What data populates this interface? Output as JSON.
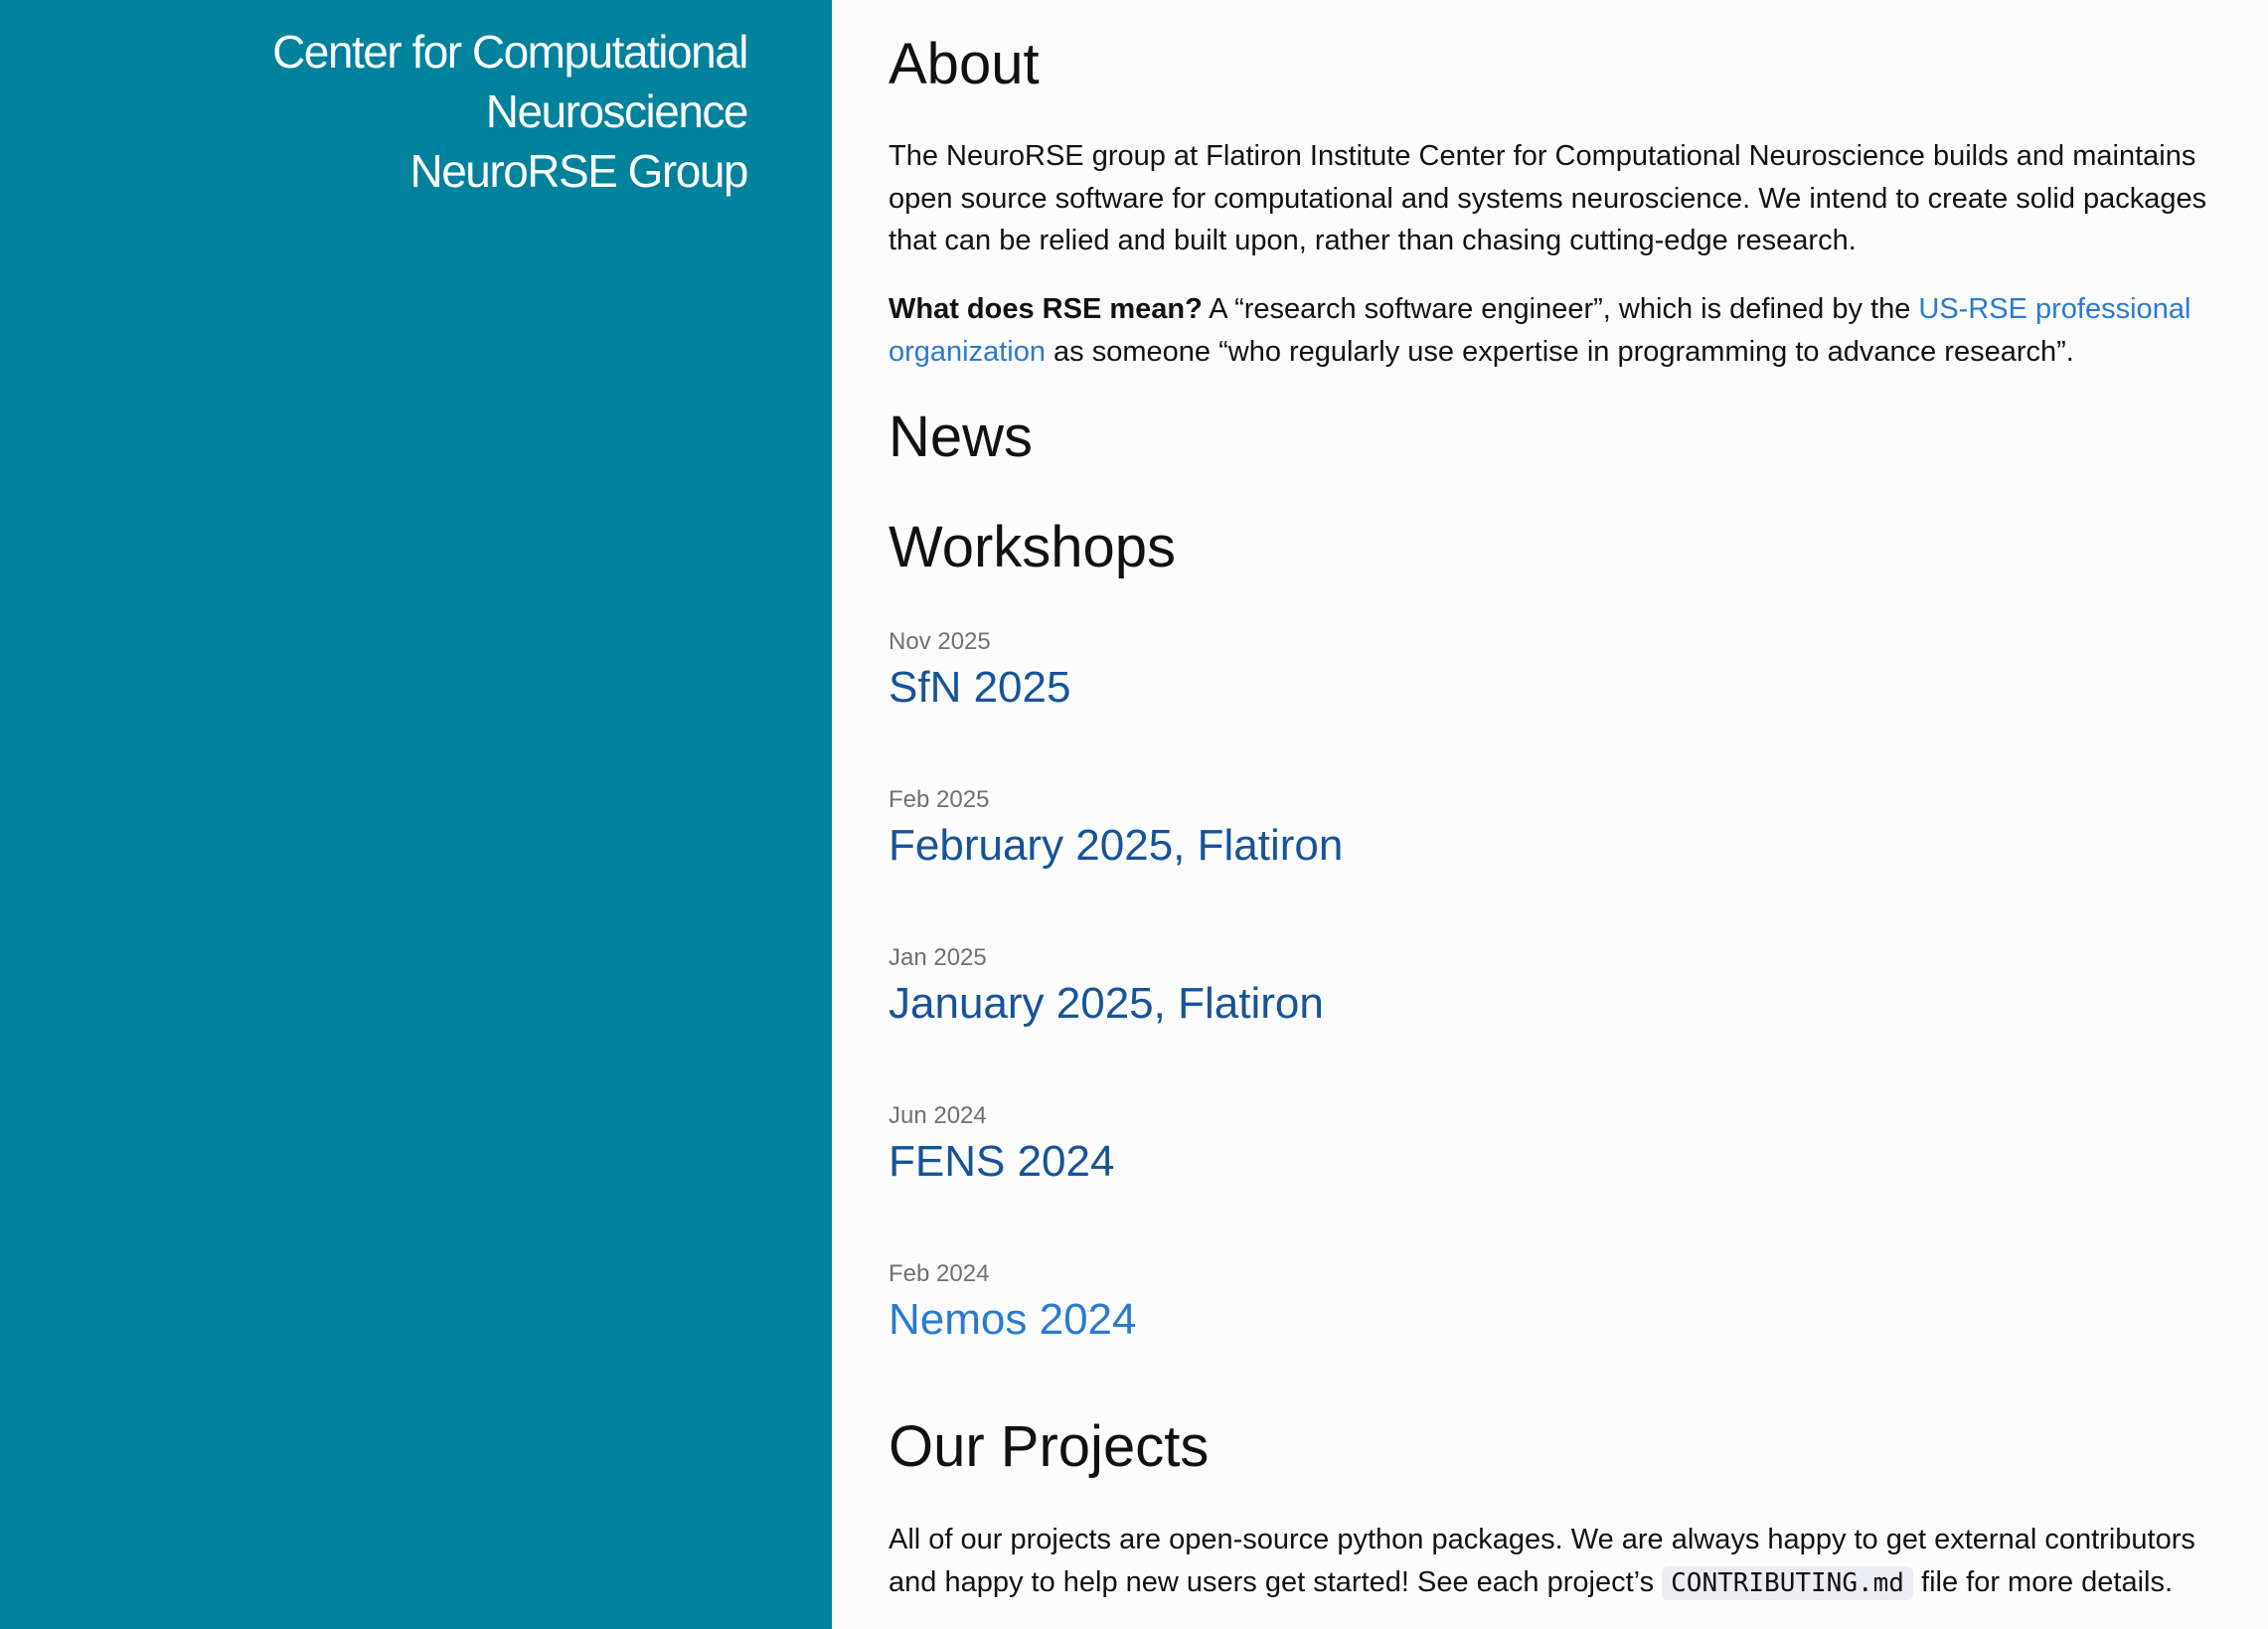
{
  "sidebar": {
    "title_line1": "Center for Computational Neuroscience",
    "title_line2": "NeuroRSE Group"
  },
  "about": {
    "heading": "About",
    "para1": "The NeuroRSE group at Flatiron Institute Center for Computational Neuroscience builds and maintains open source software for computational and systems neuroscience. We intend to create solid packages that can be relied and built upon, rather than chasing cutting-edge research.",
    "rse_question": "What does RSE mean?",
    "rse_text_before": " A “research software engineer”, which is defined by the ",
    "rse_link": "US-RSE professional organization",
    "rse_text_after": " as someone “who regularly use expertise in programming to advance research”."
  },
  "news": {
    "heading": "News"
  },
  "workshops": {
    "heading": "Workshops",
    "items": [
      {
        "date": "Nov 2025",
        "title": "SfN 2025"
      },
      {
        "date": "Feb 2025",
        "title": "February 2025, Flatiron"
      },
      {
        "date": "Jan 2025",
        "title": "January 2025, Flatiron"
      },
      {
        "date": "Jun 2024",
        "title": "FENS 2024"
      },
      {
        "date": "Feb 2024",
        "title": "Nemos 2024"
      }
    ]
  },
  "projects": {
    "heading": "Our Projects",
    "text_before": "All of our projects are open-source python packages. We are always happy to get external contributors and happy to help new users get started! See each project’s ",
    "code": "CONTRIBUTING.md",
    "text_after": " file for more details."
  },
  "colors": {
    "sidebar_bg": "#00819c",
    "link": "#2a7ad2",
    "post_link": "#175399"
  }
}
